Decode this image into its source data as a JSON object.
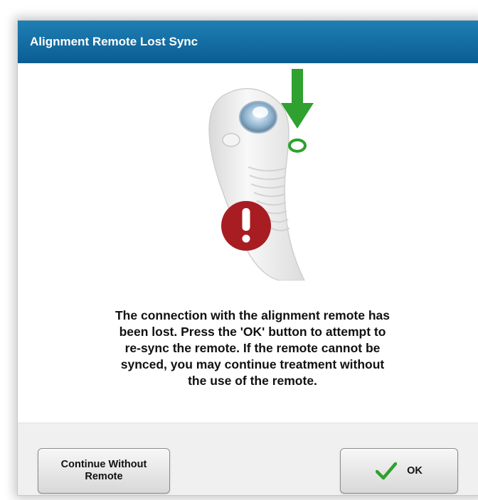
{
  "dialog": {
    "title": "Alignment Remote Lost Sync",
    "message": "The connection with the alignment remote has been lost. Press the 'OK' button to attempt to re-sync the remote. If the remote cannot be synced, you may continue treatment without the use of the remote.",
    "message_lines": [
      "The connection with the alignment remote has",
      "been lost. Press the 'OK' button to attempt to",
      "re-sync the remote. If the remote cannot be",
      "synced, you may continue treatment without",
      "the use of the remote."
    ],
    "illustration": {
      "icons": [
        "remote-control-icon",
        "green-arrow-down-icon",
        "green-ring-indicator-icon",
        "red-warning-exclamation-icon"
      ]
    },
    "buttons": {
      "continue_label_line1": "Continue Without",
      "continue_label_line2": "Remote",
      "ok_label": "OK"
    },
    "colors": {
      "title_bar": "#0d6299",
      "arrow": "#2ea12e",
      "warning": "#a81d22",
      "check": "#2ea12e"
    }
  }
}
